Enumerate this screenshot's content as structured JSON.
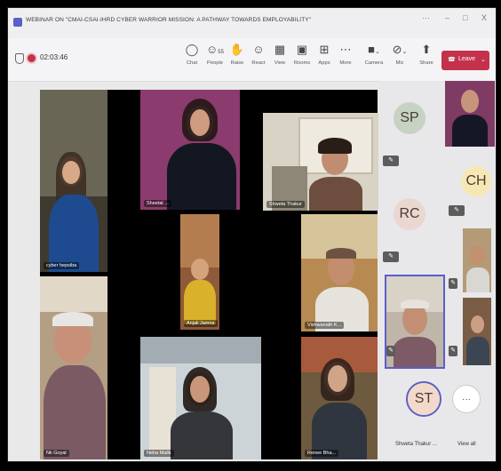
{
  "window": {
    "title": "WEBINAR ON \"CMAI-CSAI-IHRD CYBER WARRIOR MISSION: A PATHWAY TOWARDS EMPLOYABILITY\"",
    "controls": [
      "···",
      "–",
      "□",
      "X"
    ]
  },
  "toolbar": {
    "timer": "02:03:46",
    "buttons": [
      {
        "label": "Chat",
        "icon": "chat-icon"
      },
      {
        "label": "People",
        "icon": "people-icon",
        "badge": "55"
      },
      {
        "label": "Raise",
        "icon": "hand-icon"
      },
      {
        "label": "React",
        "icon": "smile-icon"
      },
      {
        "label": "View",
        "icon": "grid-icon"
      },
      {
        "label": "Rooms",
        "icon": "rooms-icon"
      },
      {
        "label": "Apps",
        "icon": "plus-icon"
      },
      {
        "label": "More",
        "icon": "more-icon"
      },
      {
        "label": "Camera",
        "icon": "camera-icon"
      },
      {
        "label": "Mic",
        "icon": "mic-off-icon"
      },
      {
        "label": "Share",
        "icon": "share-icon"
      }
    ],
    "leave_label": "Leave"
  },
  "colors": {
    "accent": "#5b5fc7",
    "leave": "#c4314b"
  },
  "stage": {
    "tiles": [
      {
        "name": "cyber hepsiba"
      },
      {
        "name": "Sheetal ..."
      },
      {
        "name": "Shweta Thakur"
      },
      {
        "name": "Anjali Jamna"
      },
      {
        "name": "Vishwanath K..."
      },
      {
        "name": "Nk Goyal"
      },
      {
        "name": "Neha Malik"
      },
      {
        "name": "Renee Bha..."
      }
    ]
  },
  "sidebar": {
    "avatars": [
      {
        "initials": "SP",
        "color": "#c6d3c2"
      },
      {
        "initials": "CH",
        "color": "#f7e7b4"
      },
      {
        "initials": "RC",
        "color": "#ead7d0"
      },
      {
        "initials": "ST",
        "color": "#f3d9c9",
        "label": "Shweta Thakur ..."
      }
    ],
    "view_all_label": "View all",
    "view_all_icon": "···"
  }
}
